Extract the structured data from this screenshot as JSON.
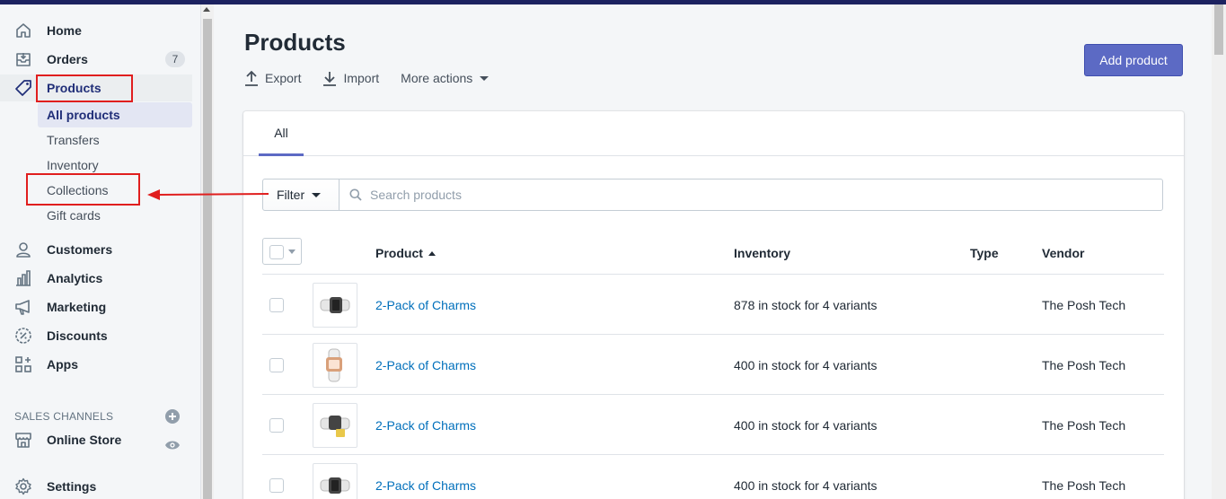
{
  "sidebar": {
    "items": [
      {
        "label": "Home",
        "icon": "home-icon"
      },
      {
        "label": "Orders",
        "icon": "orders-icon",
        "badge": "7"
      },
      {
        "label": "Products",
        "icon": "tag-icon"
      },
      {
        "label": "Customers",
        "icon": "person-icon"
      },
      {
        "label": "Analytics",
        "icon": "bar-chart-icon"
      },
      {
        "label": "Marketing",
        "icon": "megaphone-icon"
      },
      {
        "label": "Discounts",
        "icon": "discount-icon"
      },
      {
        "label": "Apps",
        "icon": "apps-icon"
      }
    ],
    "products_sub": [
      "All products",
      "Transfers",
      "Inventory",
      "Collections",
      "Gift cards"
    ],
    "sales_channels_label": "SALES CHANNELS",
    "online_store": "Online Store",
    "settings": "Settings"
  },
  "page": {
    "title": "Products",
    "actions": {
      "export": "Export",
      "import": "Import",
      "more": "More actions"
    },
    "add_button": "Add product"
  },
  "tabs": [
    "All"
  ],
  "filter": {
    "button": "Filter",
    "search_placeholder": "Search products"
  },
  "table": {
    "headers": {
      "product": "Product",
      "inventory": "Inventory",
      "type": "Type",
      "vendor": "Vendor"
    },
    "rows": [
      {
        "name": "2-Pack of Charms",
        "inventory": "878 in stock for 4 variants",
        "type": "",
        "vendor": "The Posh Tech"
      },
      {
        "name": "2-Pack of Charms",
        "inventory": "400 in stock for 4 variants",
        "type": "",
        "vendor": "The Posh Tech"
      },
      {
        "name": "2-Pack of Charms",
        "inventory": "400 in stock for 4 variants",
        "type": "",
        "vendor": "The Posh Tech"
      },
      {
        "name": "2-Pack of Charms",
        "inventory": "400 in stock for 4 variants",
        "type": "",
        "vendor": "The Posh Tech"
      }
    ]
  },
  "colors": {
    "accent": "#5c6ac4",
    "link": "#006fbb",
    "annotation": "#e01e1e",
    "topbar": "#1c2260"
  }
}
